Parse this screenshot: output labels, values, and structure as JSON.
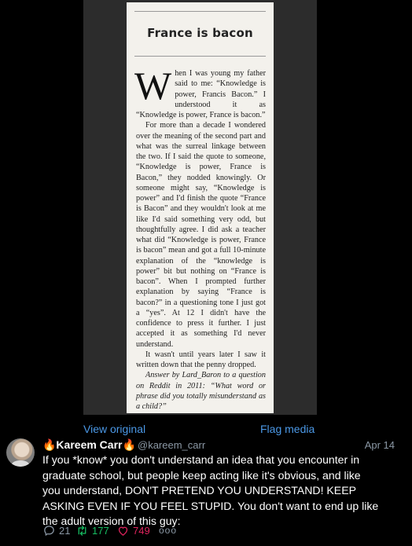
{
  "media": {
    "title": "France is bacon",
    "drop_cap": "W",
    "paragraphs": [
      "hen I was young my father said to me: “Knowledge is power, Francis Bacon.” I understood it as “Knowledge is power, France is bacon.”",
      "For more than a decade I wondered over the meaning of the second part and what was the surreal linkage between the two. If I said the quote to someone, “Knowledge is power, France is Bacon,” they nodded knowingly. Or someone might say, “Knowledge is power” and I'd finish the quote “France is Bacon” and they wouldn't look at me like I'd said something very odd, but thoughtfully agree. I did ask a teacher what did “Knowledge is power, France is bacon” mean and got a full 10-minute explanation of the “knowledge is power” bit but nothing on “France is bacon”. When I prompted further explanation by saying “France is bacon?” in a questioning tone I just got a “yes”. At 12 I didn't have the confidence to press it further. I just accepted it as something I'd never understand.",
      "It wasn't until years later I saw it written down that the penny dropped."
    ],
    "source": "Answer by Lard_Baron to a question on Reddit in 2011: “What word or phrase did you totally misunderstand as a child?”"
  },
  "media_actions": {
    "view_original": "View original",
    "flag_media": "Flag media"
  },
  "tweet": {
    "display_name": "🔥Kareem Carr🔥",
    "handle": "@kareem_carr",
    "date": "Apr 14",
    "text": "If you *know* you don't understand an idea that you encounter in\ngraduate school, but people keep acting like it's obvious, and like\nyou understand, DON'T PRETEND YOU UNDERSTAND! KEEP\nASKING EVEN IF YOU FEEL STUPID. You don't want to end up like\nthe adult version of this guy:",
    "replies": "21",
    "retweets": "177",
    "likes": "749",
    "more": "ooo"
  },
  "colors": {
    "link": "#4b98e6",
    "muted": "#8b98a5",
    "retweet": "#17bf63",
    "like": "#e0245e"
  },
  "icons": [
    "reply-icon",
    "retweet-icon",
    "like-icon",
    "more-icon"
  ]
}
